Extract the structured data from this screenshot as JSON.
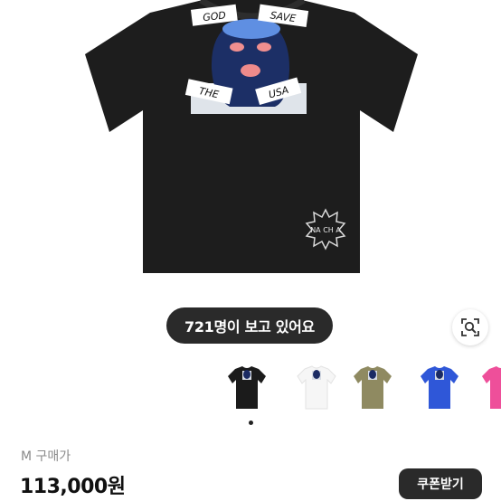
{
  "product": {
    "shirt_print": {
      "words": [
        "GOD",
        "SAVE",
        "THE",
        "USA"
      ],
      "badge": "NA CH A"
    },
    "viewers_text": "721명이 보고 있어요",
    "lens_icon": "lens-search-icon",
    "thumbnails": [
      {
        "name": "black",
        "color": "#1b1b1b"
      },
      {
        "name": "white",
        "color": "#f6f6f6"
      },
      {
        "name": "olive",
        "color": "#8f8a61"
      },
      {
        "name": "blue",
        "color": "#2f57d8"
      },
      {
        "name": "pink",
        "color": "#ee4f9a"
      }
    ],
    "price_label": "M 구매가",
    "price": "113,000원",
    "coupon_label": "쿠폰받기"
  }
}
